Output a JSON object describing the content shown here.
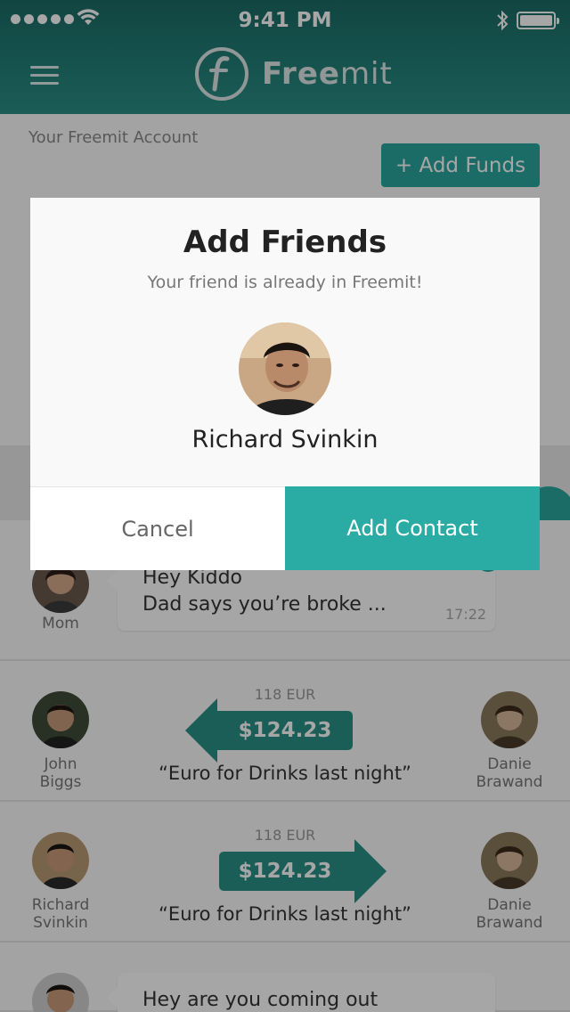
{
  "status_bar": {
    "time": "9:41 PM"
  },
  "app": {
    "logo_name_bold": "Free",
    "logo_name_light": "mit"
  },
  "account": {
    "label": "Your Freemit Account",
    "add_funds_label": "+ Add Funds"
  },
  "feed": {
    "message1": {
      "sender": "Mom",
      "line1": "Hey Kiddo",
      "line2": "Dad says you’re broke ...",
      "time": "17:22"
    },
    "transfer1": {
      "from_name": "John\nBiggs",
      "to_name": "Danie\nBrawand",
      "eur": "118 EUR",
      "amount": "$124.23",
      "note": "“Euro for Drinks last night”",
      "direction": "left"
    },
    "transfer2": {
      "from_name": "Richard\nSvinkin",
      "to_name": "Danie\nBrawand",
      "eur": "118 EUR",
      "amount": "$124.23",
      "note": "“Euro for Drinks last night”",
      "direction": "right"
    },
    "message2": {
      "line1": "Hey are you coming out"
    }
  },
  "modal": {
    "title": "Add Friends",
    "subtitle": "Your friend is already in Freemit!",
    "friend_name": "Richard Svinkin",
    "cancel_label": "Cancel",
    "add_contact_label": "Add Contact"
  },
  "colors": {
    "accent": "#2aa79e",
    "header": "#1b6b66"
  }
}
